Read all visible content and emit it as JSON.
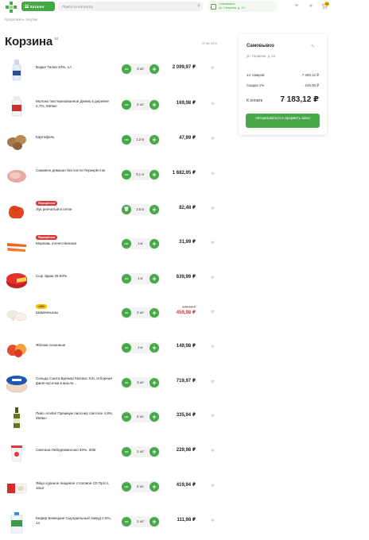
{
  "header": {
    "catalog_label": "Каталог",
    "search_placeholder": "Поиск по каталогу",
    "delivery_line1": "Самовывоз",
    "delivery_line2": "ул. Гагарина, д. 13",
    "cart_count": "14"
  },
  "breadcrumb": "продолжить покупки",
  "cart": {
    "title": "Корзина",
    "count": "14",
    "clear_label": "Очистить"
  },
  "items": [
    {
      "name": "Водка Талка 40%, 1л",
      "qty": "3 шт",
      "price": "2 099,97 ₽"
    },
    {
      "name": "Молоко пастеризованное Домик в деревне 2,7%, 930мл",
      "qty": "2 шт",
      "price": "169,98 ₽"
    },
    {
      "name": "Картофель",
      "qty": "1,2 кг",
      "price": "47,99 ₽"
    },
    {
      "name": "Сиамено домашн без кости Перекрёсток",
      "qty": "5,1 кг",
      "price": "1 682,95 ₽"
    },
    {
      "tag": "Перекрёсток",
      "name": "Лук репчатый в сетке",
      "qty": "2,5 кг",
      "price": "82,48 ₽"
    },
    {
      "tag": "Перекрёсток",
      "name": "Морковь отечественная",
      "qty": "1 кг",
      "price": "31,99 ₽"
    },
    {
      "name": "Сыр Эдам 35-50%",
      "qty": "1 кг",
      "price": "639,99 ₽"
    },
    {
      "tag": "-10%",
      "name": "Шампиньоны",
      "qty": "2 шт",
      "old_price": "509,98 ₽",
      "price": "459,98 ₽"
    },
    {
      "name": "Яблоки сезонные",
      "qty": "2 кг",
      "price": "149,98 ₽"
    },
    {
      "name": "Сельдь Санта Бремор Матиас XXL отборная филе-кусочки в масле...",
      "qty": "3 шт",
      "price": "719,97 ₽"
    },
    {
      "name": "Пиво Amstel Премиум пилснер светлое 4,8%, 450мл",
      "qty": "6 шт",
      "price": "335,94 ₽"
    },
    {
      "name": "Сметана Лебедянмолоко 20%, 300г",
      "qty": "2 шт",
      "price": "229,98 ₽"
    },
    {
      "name": "Яйцо куриное пищевое столовое С0 Пр/сл, 10шт",
      "qty": "6 шт",
      "price": "419,94 ₽"
    },
    {
      "name": "Кефир Бежецкие Сыродельный Завод 2,5%, 1л",
      "qty": "2 шт",
      "price": "111,98 ₽"
    }
  ],
  "summary": {
    "pickup_label": "Самовывоз",
    "address": "ул. Гагарина, д. 13",
    "goods_label": "14 товаров",
    "goods_value": "7 283,12 ₽",
    "discount_label": "Скидка 1%",
    "discount_value": "- 100,00 ₽",
    "total_label": "К оплате",
    "total_value": "7 183,12 ₽",
    "checkout_label": "Авторизоваться и оформить заказ"
  },
  "colors": {
    "accent": "#47a847",
    "sale": "#d93636",
    "badge": "#f5c400"
  }
}
